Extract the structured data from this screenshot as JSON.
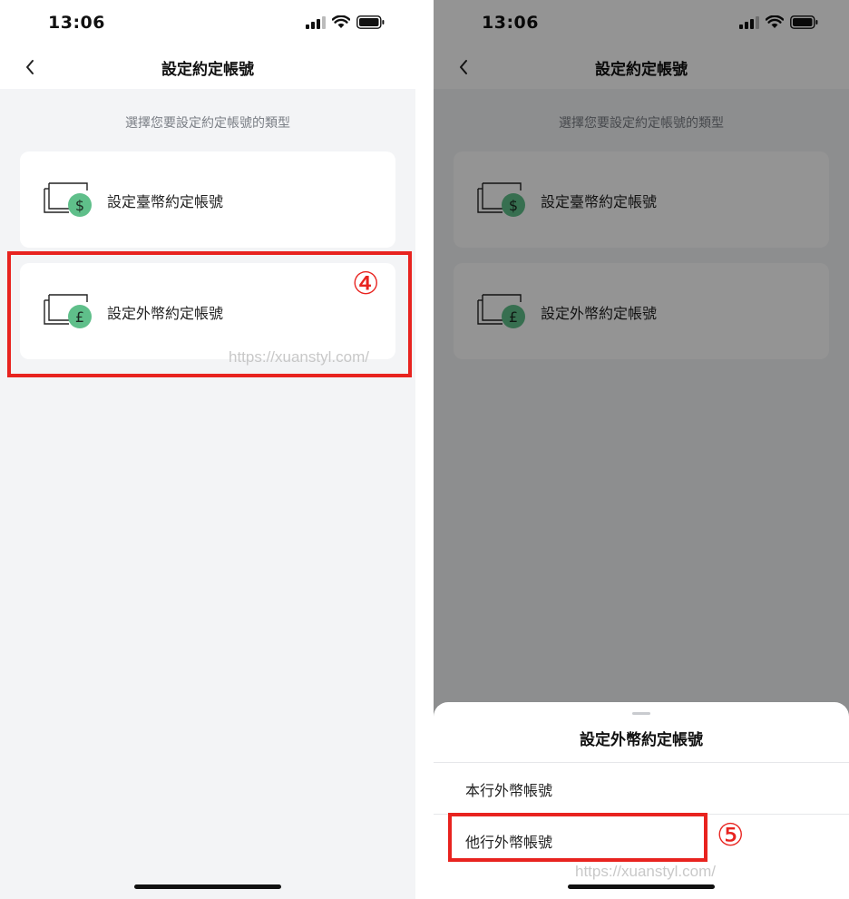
{
  "status_bar": {
    "time": "13:06"
  },
  "nav": {
    "title": "設定約定帳號"
  },
  "subtitle": "選擇您要設定約定帳號的類型",
  "options": [
    {
      "label": "設定臺幣約定帳號",
      "icon": "dollar-wallet-icon",
      "currency_symbol": "$"
    },
    {
      "label": "設定外幣約定帳號",
      "icon": "pound-wallet-icon",
      "currency_symbol": "£"
    }
  ],
  "sheet": {
    "title": "設定外幣約定帳號",
    "options": [
      "本行外幣帳號",
      "他行外幣帳號"
    ]
  },
  "annotations": {
    "step4": "④",
    "step5": "⑤",
    "watermark": "https://xuanstyl.com/"
  },
  "colors": {
    "highlight": "#e8231f",
    "icon_green": "#5fbf8a",
    "background": "#f3f4f6"
  }
}
